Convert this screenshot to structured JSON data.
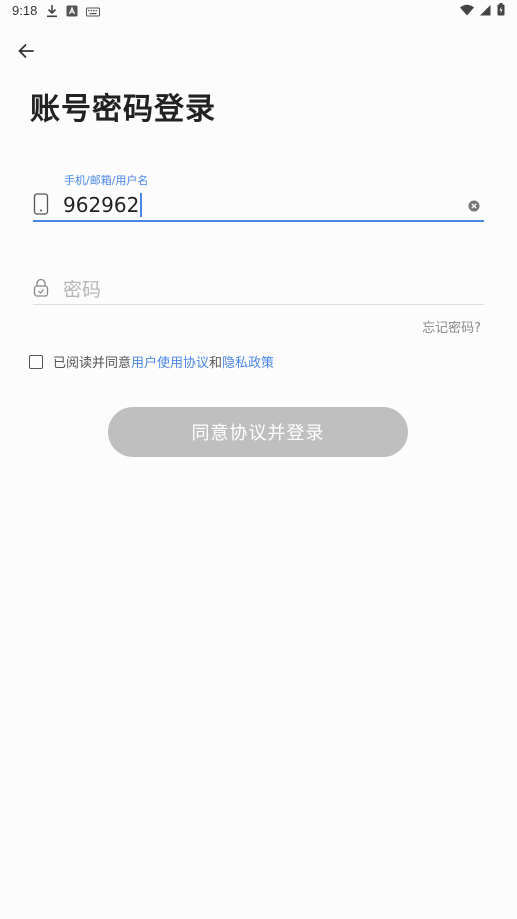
{
  "status_bar": {
    "time": "9:18",
    "left_icons": [
      "download-icon",
      "a-notification-icon",
      "keyboard-icon"
    ],
    "right_icons": [
      "wifi-icon",
      "cellular-icon",
      "battery-charging-icon"
    ]
  },
  "header": {
    "back_icon": "arrow-left-icon",
    "title": "账号密码登录"
  },
  "phone_field": {
    "label": "手机/邮箱/用户名",
    "value": "962962",
    "icon": "phone-icon",
    "clear_icon": "clear-icon"
  },
  "password_field": {
    "placeholder": "密码",
    "icon": "lock-icon"
  },
  "forgot_password": "忘记密码?",
  "agreement": {
    "prefix": "已阅读并同意",
    "terms_link": "用户使用协议",
    "conjunction": "和",
    "privacy_link": "隐私政策",
    "checked": false
  },
  "login_button": {
    "label": "同意协议并登录",
    "enabled": false
  },
  "colors": {
    "accent": "#4a86e8",
    "button_disabled": "#bfbfbf",
    "background": "#fcfcfc"
  }
}
